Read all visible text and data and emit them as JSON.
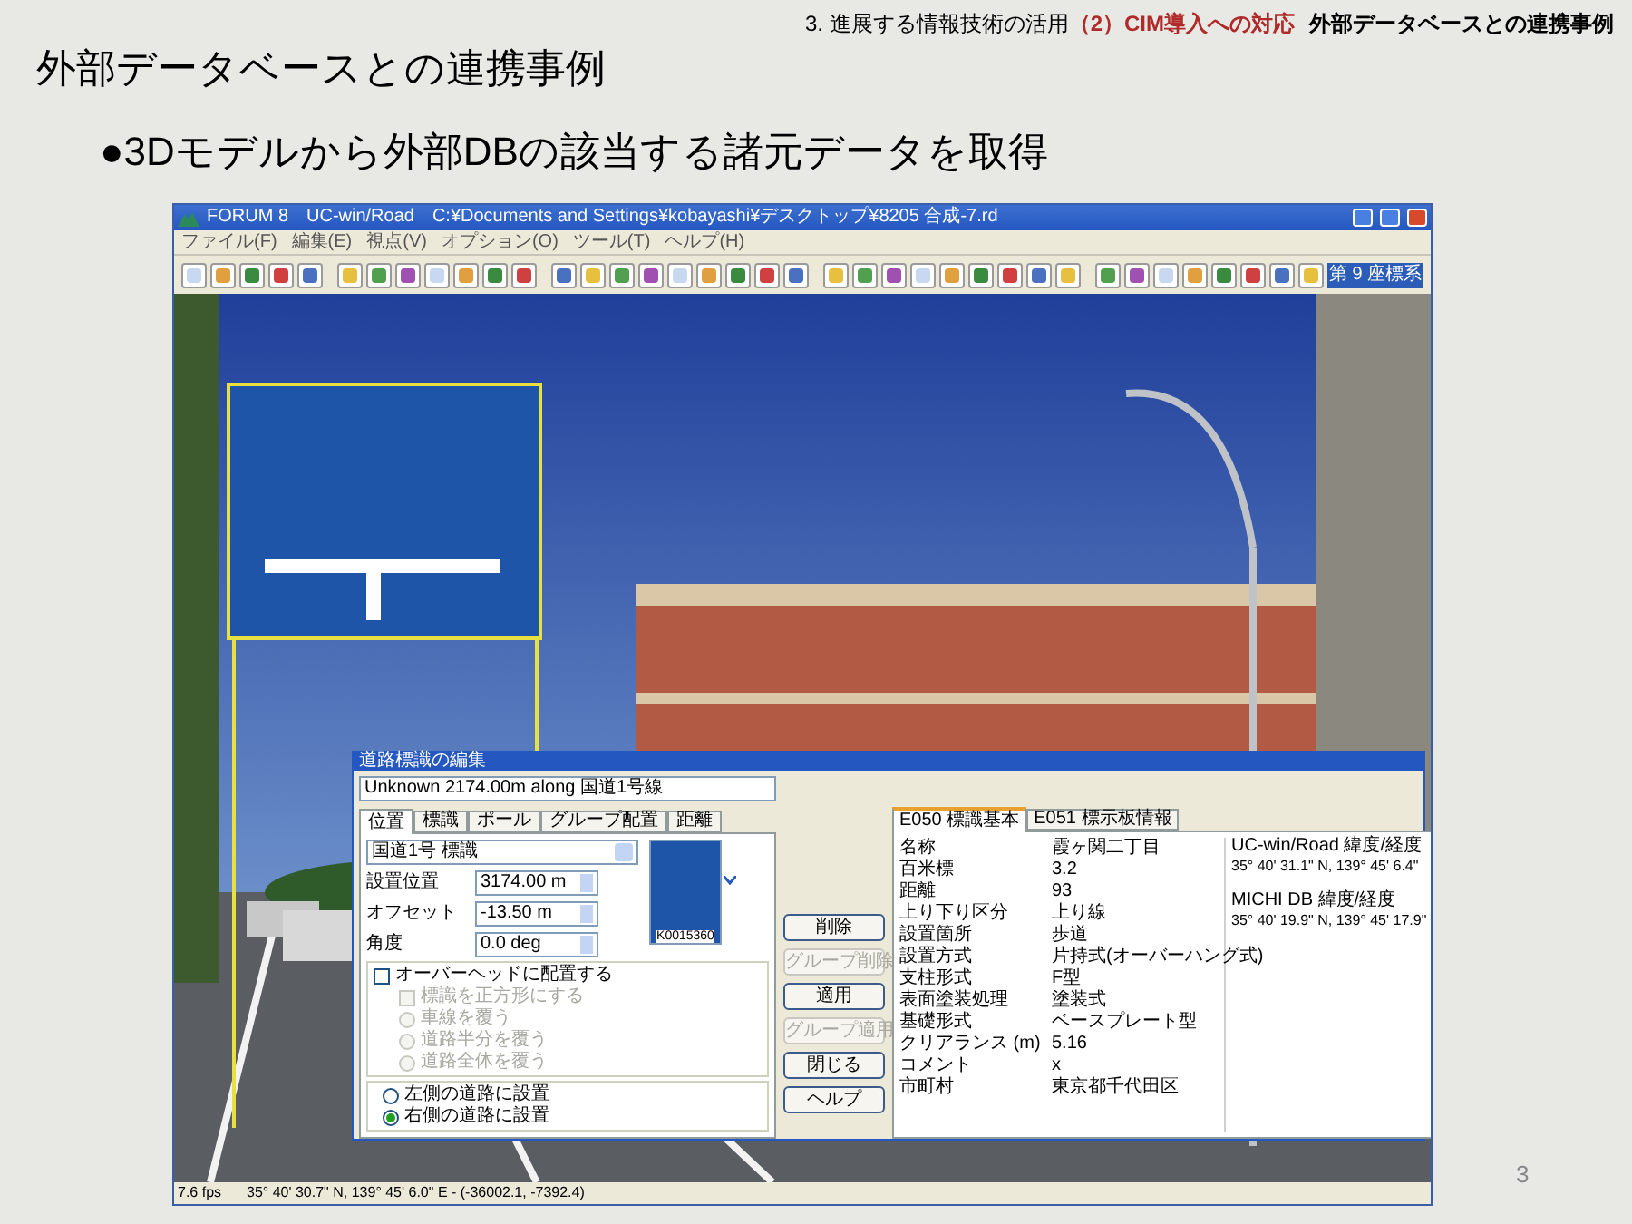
{
  "breadcrumb": [
    {
      "text": "3. 進展する情報技術の活用",
      "kind": "plain"
    },
    {
      "text": "（2）CIM導入への対応",
      "kind": "highlight"
    },
    {
      "text": "外部データベースとの連携事例",
      "kind": "bold"
    }
  ],
  "slide_title": "外部データベースとの連携事例",
  "bullet": "●3Dモデルから外部DBの該当する諸元データを取得",
  "window": {
    "title": "FORUM 8　UC-win/Road　C:¥Documents and Settings¥kobayashi¥デスクトップ¥8205 合成-7.rd",
    "menu": [
      "ファイル(F)",
      "編集(E)",
      "視点(V)",
      "オプション(O)",
      "ツール(T)",
      "ヘルプ(H)"
    ],
    "coordinate_button": "第 9 座標系",
    "status_bar": [
      "7.6 fps",
      "35°  40' 30.7\" N, 139°  45' 6.0\" E  -  (-36002.1, -7392.4)"
    ]
  },
  "dialog": {
    "title": "道路標識の編集",
    "location": "Unknown 2174.00m along 国道1号線",
    "tabs": [
      {
        "label": "位置",
        "selected": true
      },
      {
        "label": "標識",
        "selected": false
      },
      {
        "label": "ポール",
        "selected": false
      },
      {
        "label": "グループ配置",
        "selected": false
      },
      {
        "label": "距離",
        "selected": false
      }
    ],
    "sign_type": "国道1号 標識",
    "fields": [
      {
        "label": "設置位置",
        "value": "3174.00 m"
      },
      {
        "label": "オフセット",
        "value": "-13.50 m"
      },
      {
        "label": "角度",
        "value": "0.0 deg"
      }
    ],
    "sign_code": "K0015360",
    "overhead": {
      "label": "オーバーヘッドに配置する",
      "checked": false
    },
    "overhead_options": [
      {
        "label": "標識を正方形にする",
        "kind": "checkbox",
        "checked": false,
        "disabled": true
      },
      {
        "label": "車線を覆う",
        "kind": "radio",
        "selected": false,
        "disabled": true
      },
      {
        "label": "道路半分を覆う",
        "kind": "radio",
        "selected": false,
        "disabled": true
      },
      {
        "label": "道路全体を覆う",
        "kind": "radio",
        "selected": false,
        "disabled": true
      }
    ],
    "side": [
      {
        "label": "左側の道路に設置",
        "selected": false
      },
      {
        "label": "右側の道路に設置",
        "selected": true
      }
    ],
    "buttons": [
      {
        "label": "削除",
        "disabled": false
      },
      {
        "label": "グループ削除",
        "disabled": true
      },
      {
        "label": "適用",
        "disabled": false
      },
      {
        "label": "グループ適用",
        "disabled": true
      },
      {
        "label": "閉じる",
        "disabled": false
      },
      {
        "label": "ヘルプ",
        "disabled": false
      }
    ],
    "info_tabs": [
      {
        "label": "E050 標識基本",
        "selected": true
      },
      {
        "label": "E051 標示板情報",
        "selected": false
      }
    ],
    "info_rows": [
      {
        "label": "名称",
        "value": "霞ヶ関二丁目"
      },
      {
        "label": "百米標",
        "value": "3.2"
      },
      {
        "label": "距離",
        "value": "93"
      },
      {
        "label": "上り下り区分",
        "value": "上り線"
      },
      {
        "label": "設置箇所",
        "value": "歩道"
      },
      {
        "label": "設置方式",
        "value": "片持式(オーバーハング式)"
      },
      {
        "label": "支柱形式",
        "value": "F型"
      },
      {
        "label": "表面塗装処理",
        "value": "塗装式"
      },
      {
        "label": "基礎形式",
        "value": "ベースプレート型"
      },
      {
        "label": "クリアランス (m)",
        "value": "5.16"
      },
      {
        "label": "コメント",
        "value": "x"
      },
      {
        "label": "市町村",
        "value": "東京都千代田区"
      }
    ],
    "coordinates": [
      {
        "label": "UC-win/Road 緯度/経度",
        "value": "35°  40' 31.1\" N, 139°  45' 6.4\""
      },
      {
        "label": "MICHI DB 緯度/経度",
        "value": "35°  40' 19.9\" N, 139°  45' 17.9\""
      }
    ]
  },
  "page_number": "3"
}
